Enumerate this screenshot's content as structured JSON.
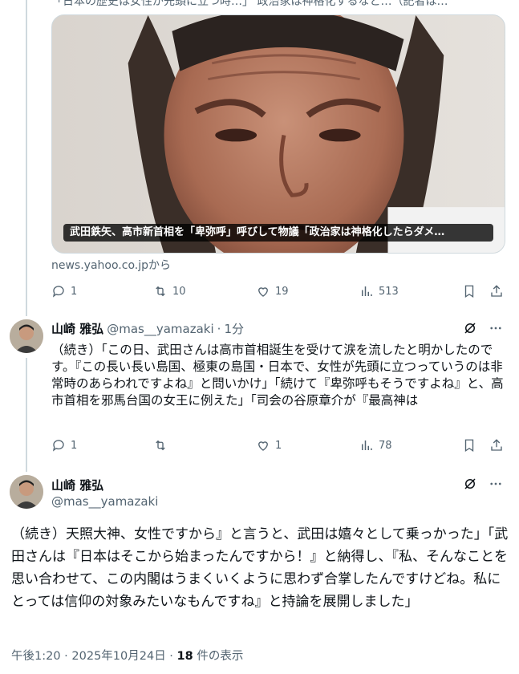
{
  "previous_tweet": {
    "cut_text": "「日本の歴史は女性が先頭に立つ時…」 政治家は神格化するなと…（記者は…",
    "card": {
      "caption": "武田鉄矢、高市新首相を「卑弥呼」呼びして物議「政治家は神格化したらダメ…",
      "source": "news.yahoo.co.jpから",
      "image_icon": "portrait-photo"
    },
    "actions": {
      "replies": "1",
      "reposts": "10",
      "likes": "19",
      "views": "513"
    }
  },
  "reply_tweet": {
    "name": "山崎 雅弘",
    "handle": "@mas__yamazaki",
    "separator": "·",
    "time": "1分",
    "text": "（続き）「この日、武田さんは高市首相誕生を受けて涙を流したと明かしたのです。『この長い長い島国、極東の島国・日本で、女性が先頭に立つっていうのは非常時のあらわれですよね』と問いかけ」「続けて『卑弥呼もそうですよね』と、高市首相を邪馬台国の女王に例えた」「司会の谷原章介が『最高神は",
    "actions": {
      "replies": "1",
      "reposts": "",
      "likes": "1",
      "views": "78"
    }
  },
  "main_tweet": {
    "name": "山崎 雅弘",
    "handle": "@mas__yamazaki",
    "text": "（続き）天照大神、女性ですから』と言うと、武田は嬉々として乗っかった」「武田さんは『日本はそこから始まったんですから！』と納得し、『私、そんなことを思い合わせて、この内閣はうまくいくように思わず合掌したんですけどね。私にとっては信仰の対象みたいなもんですね』と持論を展開しました」",
    "meta_time": "午後1:20 · 2025年10月24日 · ",
    "meta_views": "18",
    "meta_views_suffix": " 件の表示"
  },
  "icons": [
    "reply-icon",
    "repost-icon",
    "like-icon",
    "views-icon",
    "bookmark-icon",
    "share-icon",
    "grok-icon",
    "more-icon"
  ],
  "colors": {
    "text": "#0f1419",
    "secondary": "#536471",
    "border": "#cfd9de",
    "background": "#ffffff"
  }
}
